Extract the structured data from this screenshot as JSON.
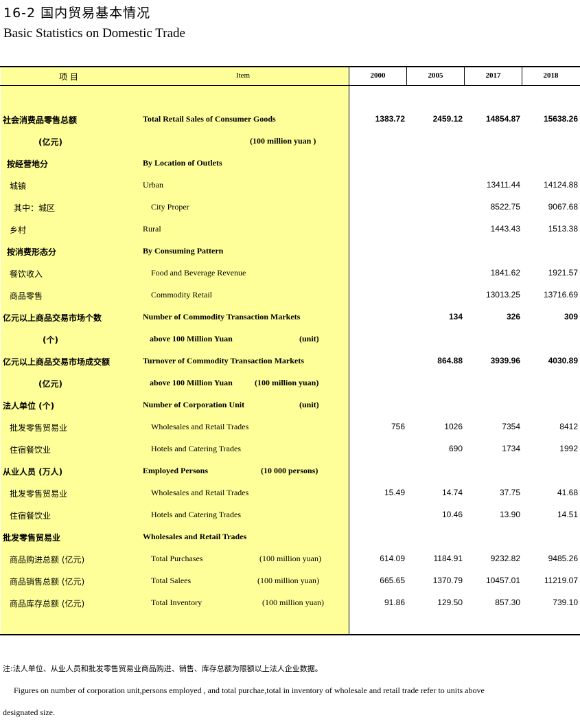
{
  "title": {
    "cn": "16-2  国内贸易基本情况",
    "en": "Basic Statistics on Domestic Trade"
  },
  "header": {
    "item_cn": "项  目",
    "item_en": "Item",
    "years": [
      "2000",
      "2005",
      "2017",
      "2018"
    ]
  },
  "rows": [
    {
      "cn": "社会消费品零售总额",
      "en": "Total Retail Sales of Consumer Goods",
      "unit": "",
      "bold": true,
      "values": [
        "1383.72",
        "2459.12",
        "14854.87",
        "15638.26"
      ]
    },
    {
      "cn": "(亿元)",
      "en": "",
      "unit": "(100 million yuan )",
      "bold": true,
      "values": [
        "",
        "",
        "",
        ""
      ]
    },
    {
      "cn": "按经营地分",
      "en": "By Location of Outlets",
      "unit": "",
      "bold": true,
      "values": [
        "",
        "",
        "",
        ""
      ]
    },
    {
      "cn": "城镇",
      "en": "Urban",
      "unit": "",
      "bold": false,
      "values": [
        "",
        "",
        "13411.44",
        "14124.88"
      ]
    },
    {
      "cn": "其中：城区",
      "en": "City Proper",
      "unit": "",
      "bold": false,
      "values": [
        "",
        "",
        "8522.75",
        "9067.68"
      ]
    },
    {
      "cn": "乡村",
      "en": "Rural",
      "unit": "",
      "bold": false,
      "values": [
        "",
        "",
        "1443.43",
        "1513.38"
      ]
    },
    {
      "cn": "按消费形态分",
      "en": "By Consuming Pattern",
      "unit": "",
      "bold": true,
      "values": [
        "",
        "",
        "",
        ""
      ]
    },
    {
      "cn": "餐饮收入",
      "en": "Food and Beverage Revenue",
      "unit": "",
      "bold": false,
      "values": [
        "",
        "",
        "1841.62",
        "1921.57"
      ]
    },
    {
      "cn": "商品零售",
      "en": "Commodity Retail",
      "unit": "",
      "bold": false,
      "values": [
        "",
        "",
        "13013.25",
        "13716.69"
      ]
    },
    {
      "cn": "亿元以上商品交易市场个数",
      "en": "Number of Commodity Transaction Markets",
      "unit": "",
      "bold": true,
      "values": [
        "",
        "134",
        "326",
        "309"
      ]
    },
    {
      "cn": "(个)",
      "en": "above 100 Million Yuan",
      "unit": "(unit)",
      "bold": true,
      "values": [
        "",
        "",
        "",
        ""
      ]
    },
    {
      "cn": "亿元以上商品交易市场成交额",
      "en": "Turnover of Commodity Transaction Markets",
      "unit": "",
      "bold": true,
      "values": [
        "",
        "864.88",
        "3939.96",
        "4030.89"
      ]
    },
    {
      "cn": "(亿元)",
      "en": "above 100 Million Yuan",
      "unit": "(100 million yuan)",
      "bold": true,
      "values": [
        "",
        "",
        "",
        ""
      ]
    },
    {
      "cn": "法人单位      (个)",
      "en": "Number of Corporation Unit",
      "unit": "(unit)",
      "bold": true,
      "values": [
        "",
        "",
        "",
        ""
      ]
    },
    {
      "cn": "批发零售贸易业",
      "en": "Wholesales and Retail Trades",
      "unit": "",
      "bold": false,
      "values": [
        "756",
        "1026",
        "7354",
        "8412"
      ]
    },
    {
      "cn": "住宿餐饮业",
      "en": "Hotels and  Catering Trades",
      "unit": "",
      "bold": false,
      "values": [
        "",
        "690",
        "1734",
        "1992"
      ]
    },
    {
      "cn": "从业人员      (万人)",
      "en": "Employed Persons",
      "unit": "(10 000 persons)",
      "bold": true,
      "values": [
        "",
        "",
        "",
        ""
      ]
    },
    {
      "cn": "批发零售贸易业",
      "en": "Wholesales and Retail Trades",
      "unit": "",
      "bold": false,
      "values": [
        "15.49",
        "14.74",
        "37.75",
        "41.68"
      ]
    },
    {
      "cn": "住宿餐饮业",
      "en": "Hotels and  Catering Trades",
      "unit": "",
      "bold": false,
      "values": [
        "",
        "10.46",
        "13.90",
        "14.51"
      ]
    },
    {
      "cn": "批发零售贸易业",
      "en": "Wholesales and Retail Trades",
      "unit": "",
      "bold": true,
      "values": [
        "",
        "",
        "",
        ""
      ]
    },
    {
      "cn": "商品购进总额  (亿元)",
      "en": "Total Purchases",
      "unit": "(100 million yuan)",
      "bold": false,
      "values": [
        "614.09",
        "1184.91",
        "9232.82",
        "9485.26"
      ]
    },
    {
      "cn": "商品销售总额  (亿元)",
      "en": "Total Salees",
      "unit": "(100 million yuan)",
      "bold": false,
      "values": [
        "665.65",
        "1370.79",
        "10457.01",
        "11219.07"
      ]
    },
    {
      "cn": "商品库存总额  (亿元)",
      "en": "Total Inventory",
      "unit": "(100 million yuan)",
      "bold": false,
      "values": [
        "91.86",
        "129.50",
        "857.30",
        "739.10"
      ]
    }
  ],
  "notes": {
    "cn": "注:法人单位、从业人员和批发零售贸易业商品购进、销售、库存总额为限额以上法人企业数据。",
    "en1": "Figures on number of corporation unit,persons employed , and total purchae,total in inventory of wholesale and retail trade refer to units above",
    "en2": "designated size."
  }
}
